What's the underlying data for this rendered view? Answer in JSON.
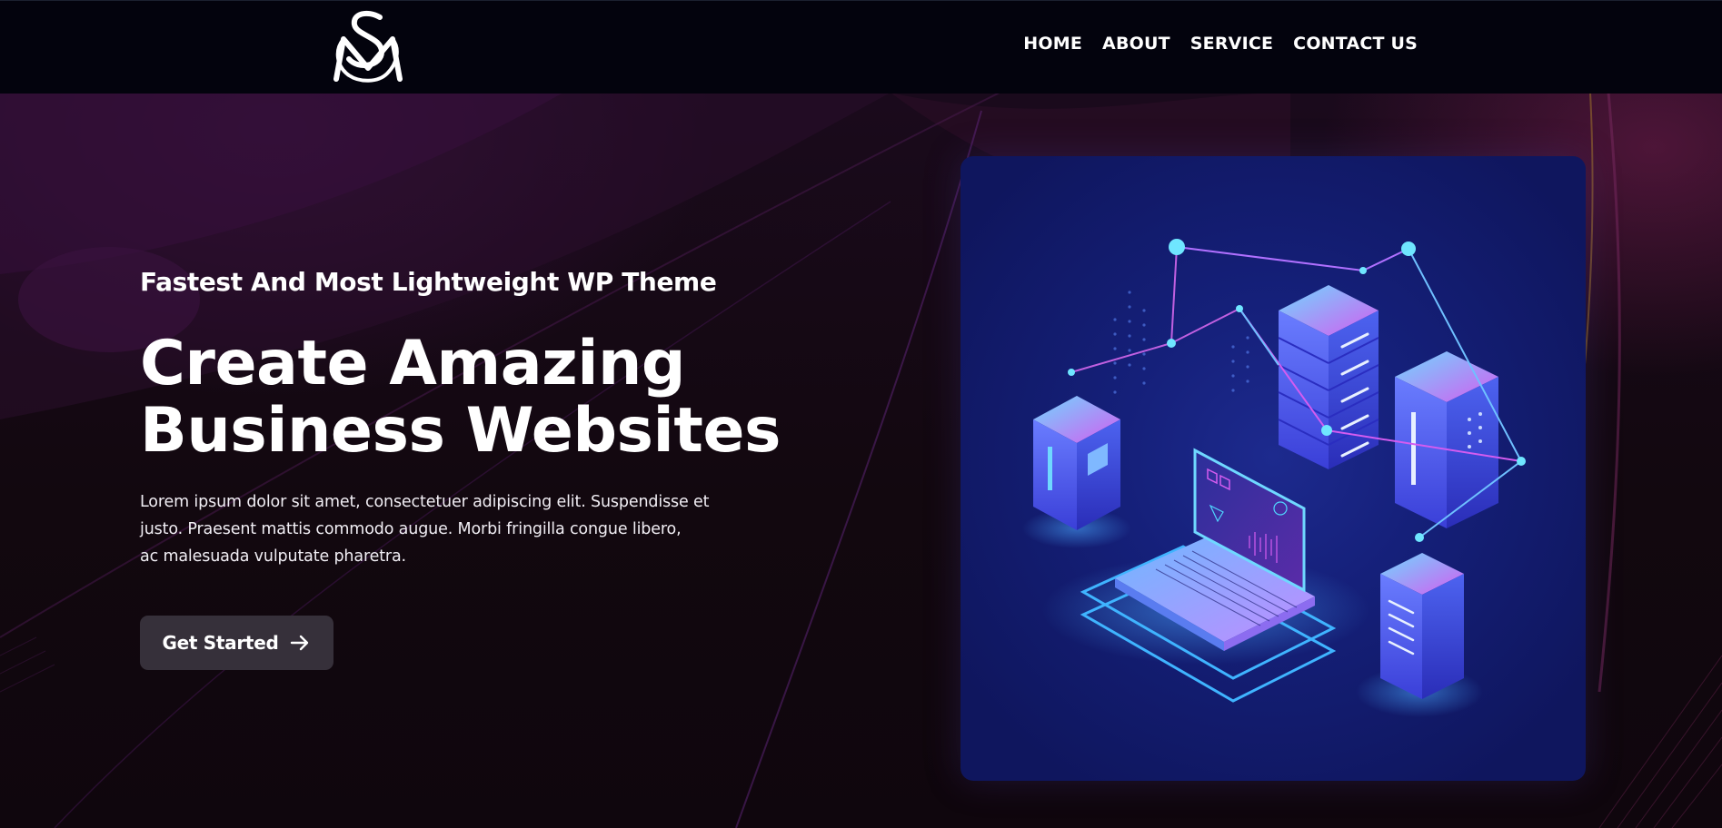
{
  "header": {
    "logo": {
      "text": "SM",
      "icon": "sm-monogram-logo"
    },
    "nav": [
      {
        "label": "HOME"
      },
      {
        "label": "ABOUT"
      },
      {
        "label": "SERVICE"
      },
      {
        "label": "CONTACT US"
      }
    ]
  },
  "hero": {
    "tagline": "Fastest And Most Lightweight WP Theme",
    "headline": [
      "Create Amazing",
      "Business Websites"
    ],
    "description": [
      "Lorem ipsum dolor sit amet, consectetuer adipiscing elit. Suspendisse et",
      "justo. Praesent mattis commodo augue. Morbi fringilla congue libero,",
      "ac malesuada vulputate pharetra."
    ],
    "cta": {
      "label": "Get Started",
      "icon": "arrow-right-icon"
    }
  },
  "illustration": {
    "icon": "isometric-servers-laptop-network-illustration"
  },
  "colors": {
    "header_bg": "#03030d",
    "hero_bg": "#12080f",
    "button_bg": "#36303a",
    "card_bg": "#15207a",
    "accent_cyan": "#4fd6ff",
    "accent_magenta": "#d44fd8"
  }
}
